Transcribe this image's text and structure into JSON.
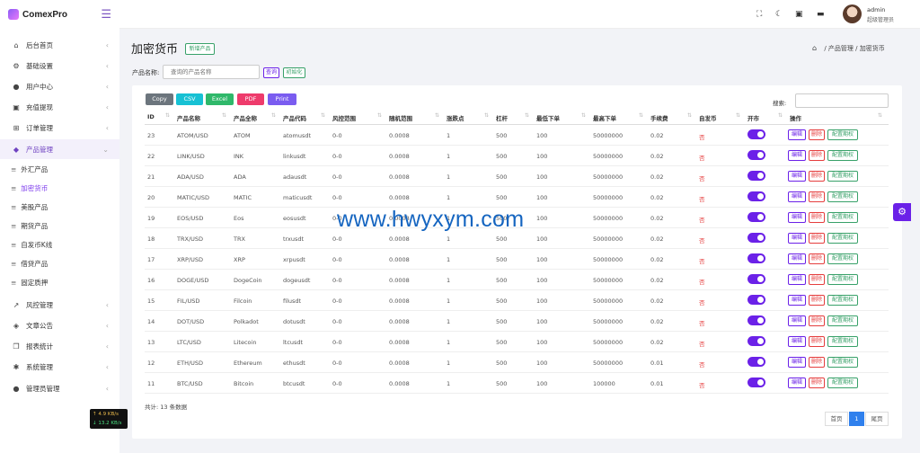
{
  "app": {
    "logo_text": "ComexPro",
    "menu_icon": "hamburger-icon"
  },
  "sidebar": {
    "items": [
      {
        "label": "后台首页",
        "icon": "home-icon"
      },
      {
        "label": "基础设置",
        "icon": "settings-icon"
      },
      {
        "label": "用户中心",
        "icon": "users-icon"
      },
      {
        "label": "充值提现",
        "icon": "wallet-icon"
      },
      {
        "label": "订单管理",
        "icon": "cart-icon"
      },
      {
        "label": "产品管理",
        "icon": "database-icon"
      },
      {
        "label": "风控管理",
        "icon": "chart-icon"
      },
      {
        "label": "文章公告",
        "icon": "layers-icon"
      },
      {
        "label": "报表统计",
        "icon": "copy-icon"
      },
      {
        "label": "系统管理",
        "icon": "gear-icon"
      },
      {
        "label": "管理员管理",
        "icon": "admins-icon"
      }
    ],
    "sub_items": [
      "外汇产品",
      "加密货币",
      "美股产品",
      "期货产品",
      "自发币K线",
      "借贷产品",
      "固定质押"
    ],
    "net_up": "↑ 4.9 KB/s",
    "net_down": "↓ 13.2 KB/s"
  },
  "topbar": {
    "icons": [
      "fullscreen-icon",
      "moon-icon",
      "image-icon",
      "chat-icon"
    ],
    "user_name": "admin",
    "user_role": "超级管理员"
  },
  "page": {
    "title": "加密货币",
    "add_button": "新增产品",
    "breadcrumb": {
      "parent": "产品管理",
      "sep": "/",
      "current": "加密货币"
    }
  },
  "filter": {
    "label": "产品名称:",
    "placeholder": "查询的产品名称",
    "search_button": "查询",
    "reset_button": "初始化"
  },
  "toolbar": {
    "export_buttons": [
      {
        "label": "Copy",
        "color": "#6c757d"
      },
      {
        "label": "CSV",
        "color": "#17c1d4"
      },
      {
        "label": "Excel",
        "color": "#2fb86a"
      },
      {
        "label": "PDF",
        "color": "#ee3b6c"
      },
      {
        "label": "Print",
        "color": "#7a5cf0"
      }
    ],
    "search_label": "搜索:"
  },
  "table": {
    "headers": [
      "ID",
      "产品名称",
      "产品全称",
      "产品代码",
      "风控范围",
      "随机范围",
      "涨跌点",
      "杠杆",
      "最低下单",
      "最高下单",
      "手续费",
      "自发币",
      "开市",
      "操作"
    ],
    "action_labels": [
      "编辑",
      "删除",
      "配置期权"
    ],
    "rows": [
      [
        "23",
        "ATOM/USD",
        "ATOM",
        "atomusdt",
        "0-0",
        "0.0008",
        "1",
        "500",
        "100",
        "50000000",
        "0.02",
        "否"
      ],
      [
        "22",
        "LINK/USD",
        "INK",
        "linkusdt",
        "0-0",
        "0.0008",
        "1",
        "500",
        "100",
        "50000000",
        "0.02",
        "否"
      ],
      [
        "21",
        "ADA/USD",
        "ADA",
        "adausdt",
        "0-0",
        "0.0008",
        "1",
        "500",
        "100",
        "50000000",
        "0.02",
        "否"
      ],
      [
        "20",
        "MATIC/USD",
        "MATIC",
        "maticusdt",
        "0-0",
        "0.0008",
        "1",
        "500",
        "100",
        "50000000",
        "0.02",
        "否"
      ],
      [
        "19",
        "EOS/USD",
        "Eos",
        "eosusdt",
        "0-0",
        "0.0008",
        "1",
        "500",
        "100",
        "50000000",
        "0.02",
        "否"
      ],
      [
        "18",
        "TRX/USD",
        "TRX",
        "trxusdt",
        "0-0",
        "0.0008",
        "1",
        "500",
        "100",
        "50000000",
        "0.02",
        "否"
      ],
      [
        "17",
        "XRP/USD",
        "XRP",
        "xrpusdt",
        "0-0",
        "0.0008",
        "1",
        "500",
        "100",
        "50000000",
        "0.02",
        "否"
      ],
      [
        "16",
        "DOGE/USD",
        "DogeCoin",
        "dogeusdt",
        "0-0",
        "0.0008",
        "1",
        "500",
        "100",
        "50000000",
        "0.02",
        "否"
      ],
      [
        "15",
        "FIL/USD",
        "Filcoin",
        "filusdt",
        "0-0",
        "0.0008",
        "1",
        "500",
        "100",
        "50000000",
        "0.02",
        "否"
      ],
      [
        "14",
        "DOT/USD",
        "Polkadot",
        "dotusdt",
        "0-0",
        "0.0008",
        "1",
        "500",
        "100",
        "50000000",
        "0.02",
        "否"
      ],
      [
        "13",
        "LTC/USD",
        "Litecoin",
        "ltcusdt",
        "0-0",
        "0.0008",
        "1",
        "500",
        "100",
        "50000000",
        "0.02",
        "否"
      ],
      [
        "12",
        "ETH/USD",
        "Ethereum",
        "ethusdt",
        "0-0",
        "0.0008",
        "1",
        "500",
        "100",
        "50000000",
        "0.01",
        "否"
      ],
      [
        "11",
        "BTC/USD",
        "Bitcoin",
        "btcusdt",
        "0-0",
        "0.0008",
        "1",
        "500",
        "100",
        "100000",
        "0.01",
        "否"
      ]
    ]
  },
  "footer": {
    "total": "共计: 13 条数据",
    "pagination": {
      "first": "首页",
      "current": "1",
      "last": "尾页"
    }
  },
  "watermark": "www.hwyxym.com"
}
